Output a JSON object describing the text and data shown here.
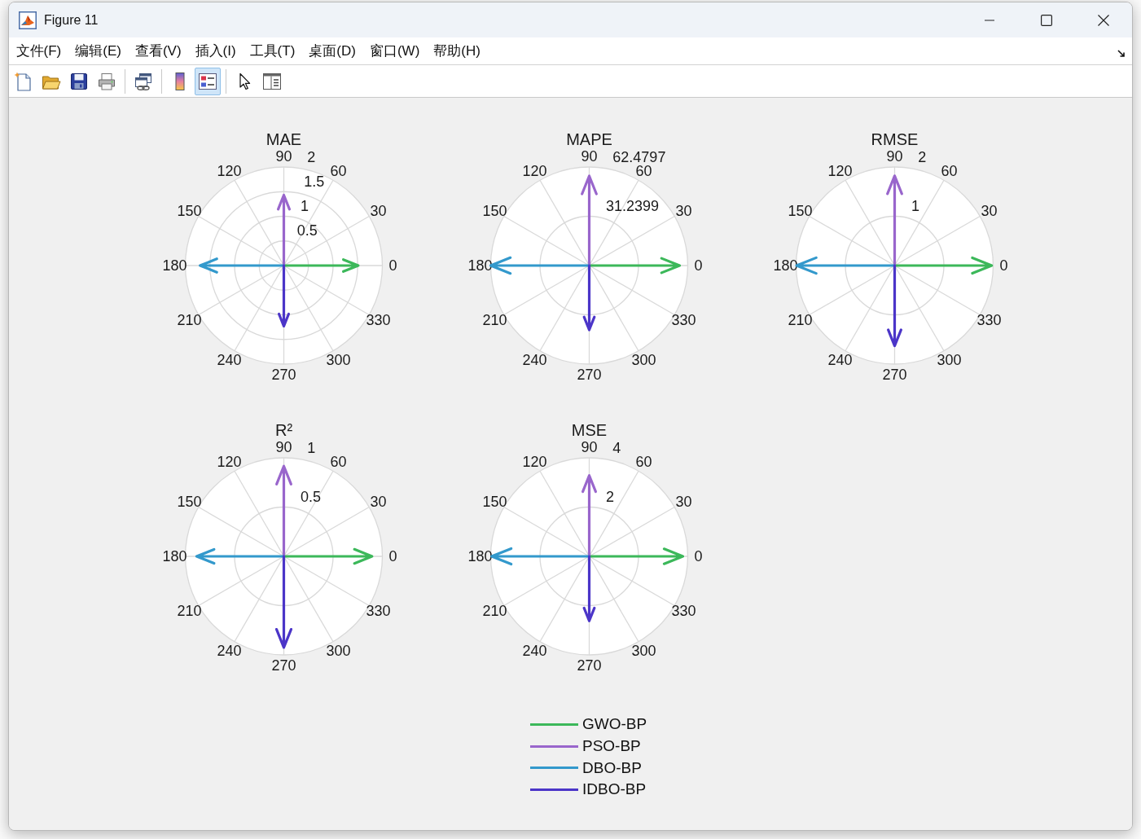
{
  "window": {
    "title": "Figure 11"
  },
  "menu": [
    "文件(F)",
    "编辑(E)",
    "查看(V)",
    "插入(I)",
    "工具(T)",
    "桌面(D)",
    "窗口(W)",
    "帮助(H)"
  ],
  "toolbar": {
    "groups": [
      [
        {
          "kind": "new",
          "pressed": false
        },
        {
          "kind": "open",
          "pressed": false
        },
        {
          "kind": "save",
          "pressed": false
        },
        {
          "kind": "print",
          "pressed": false
        }
      ],
      [
        {
          "kind": "link",
          "pressed": false
        }
      ],
      [
        {
          "kind": "colorbar",
          "pressed": false
        },
        {
          "kind": "legend",
          "pressed": true
        }
      ],
      [
        {
          "kind": "pointer",
          "pressed": false
        },
        {
          "kind": "inspector",
          "pressed": false
        }
      ]
    ]
  },
  "plots": [
    {
      "title": "MAE",
      "angle_labels": [
        "0",
        "30",
        "60",
        "90",
        "120",
        "150",
        "180",
        "210",
        "240",
        "270",
        "300",
        "330"
      ],
      "radius_labels": [
        "2",
        "1.5",
        "1",
        "0.5"
      ]
    },
    {
      "title": "MAPE",
      "angle_labels": [
        "0",
        "30",
        "60",
        "90",
        "120",
        "150",
        "180",
        "210",
        "240",
        "270",
        "300",
        "330"
      ],
      "radius_labels": [
        "62.4797",
        "31.2399"
      ]
    },
    {
      "title": "RMSE",
      "angle_labels": [
        "0",
        "30",
        "60",
        "90",
        "120",
        "150",
        "180",
        "210",
        "240",
        "270",
        "300",
        "330"
      ],
      "radius_labels": [
        "2",
        "1"
      ]
    },
    {
      "title": "R²",
      "angle_labels": [
        "0",
        "30",
        "60",
        "90",
        "120",
        "150",
        "180",
        "210",
        "240",
        "270",
        "300",
        "330"
      ],
      "radius_labels": [
        "1",
        "0.5"
      ]
    },
    {
      "title": "MSE",
      "angle_labels": [
        "0",
        "30",
        "60",
        "90",
        "120",
        "150",
        "180",
        "210",
        "240",
        "270",
        "300",
        "330"
      ],
      "radius_labels": [
        "4",
        "2"
      ]
    }
  ],
  "legend": [
    {
      "label": "GWO-BP",
      "color": "#3cb85a"
    },
    {
      "label": "PSO-BP",
      "color": "#9966cc"
    },
    {
      "label": "DBO-BP",
      "color": "#3399cc"
    },
    {
      "label": "IDBO-BP",
      "color": "#4b35c8"
    }
  ]
}
